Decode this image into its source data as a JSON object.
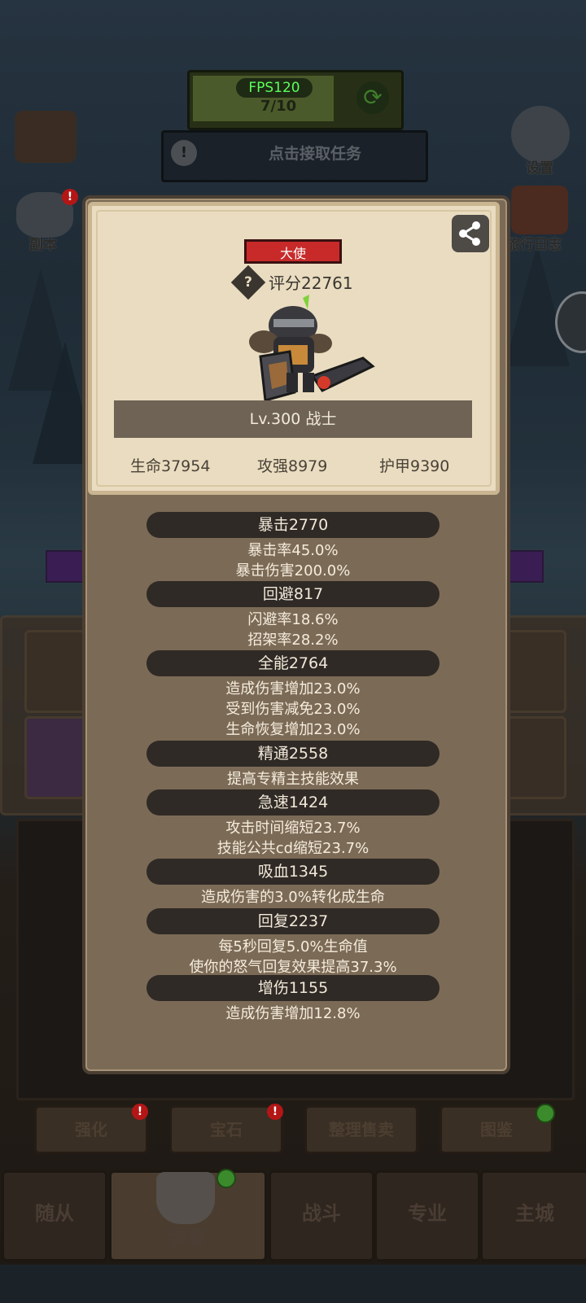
{
  "hud": {
    "fps": "FPS120",
    "fps_progress": "7/10",
    "task_button": "点击接取任务"
  },
  "side_buttons": {
    "settings": "设置",
    "dungeon": "副本",
    "travel_log": "旅行日志"
  },
  "character": {
    "title": "大使",
    "score": "评分22761",
    "level_class": "Lv.300 战士",
    "stats": {
      "hp": "生命37954",
      "attack": "攻强8979",
      "armor": "护甲9390"
    }
  },
  "attributes": [
    {
      "name": "暴击2770",
      "lines": [
        "暴击率45.0%",
        "暴击伤害200.0%"
      ]
    },
    {
      "name": "回避817",
      "lines": [
        "闪避率18.6%",
        "招架率28.2%"
      ]
    },
    {
      "name": "全能2764",
      "lines": [
        "造成伤害增加23.0%",
        "受到伤害减免23.0%",
        "生命恢复增加23.0%"
      ]
    },
    {
      "name": "精通2558",
      "lines": [
        "提高专精主技能效果"
      ]
    },
    {
      "name": "急速1424",
      "lines": [
        "攻击时间缩短23.7%",
        "技能公共cd缩短23.7%"
      ]
    },
    {
      "name": "吸血1345",
      "lines": [
        "造成伤害的3.0%转化成生命"
      ]
    },
    {
      "name": "回复2237",
      "lines": [
        "每5秒回复5.0%生命值",
        "使你的怒气回复效果提高37.3%"
      ]
    },
    {
      "name": "增伤1155",
      "lines": [
        "造成伤害增加12.8%"
      ]
    }
  ],
  "sub_buttons": [
    "强化",
    "宝石",
    "整理售卖",
    "图鉴"
  ],
  "nav": [
    "随从",
    "装备",
    "战斗",
    "专业",
    "主城"
  ],
  "colors": {
    "title_badge": "#c82a2a",
    "section_bar": "#2f2a25",
    "card": "#e9dcc0"
  }
}
